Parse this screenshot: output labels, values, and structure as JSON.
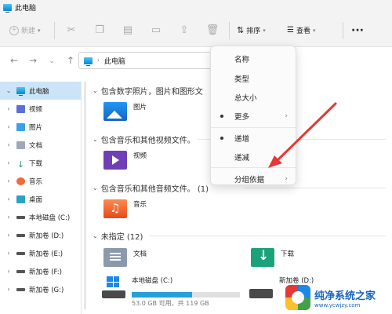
{
  "window": {
    "title": "此电脑"
  },
  "toolbar": {
    "new_label": "新建",
    "sort_label": "排序",
    "view_label": "查看",
    "more_label": "···"
  },
  "address": {
    "path": "此电脑"
  },
  "sidebar": {
    "items": [
      {
        "label": "此电脑",
        "icon": "pc-icon",
        "selected": true,
        "expanded": true
      },
      {
        "label": "视频",
        "icon": "video-folder-icon"
      },
      {
        "label": "图片",
        "icon": "picture-folder-icon"
      },
      {
        "label": "文档",
        "icon": "document-folder-icon"
      },
      {
        "label": "下载",
        "icon": "download-folder-icon"
      },
      {
        "label": "音乐",
        "icon": "music-folder-icon"
      },
      {
        "label": "桌面",
        "icon": "desktop-folder-icon"
      },
      {
        "label": "本地磁盘 (C:)",
        "icon": "drive-icon"
      },
      {
        "label": "新加卷 (D:)",
        "icon": "drive-icon"
      },
      {
        "label": "新加卷 (E:)",
        "icon": "drive-icon"
      },
      {
        "label": "新加卷 (F:)",
        "icon": "drive-icon"
      },
      {
        "label": "新加卷 (G:)",
        "icon": "drive-icon"
      }
    ]
  },
  "groups": [
    {
      "header": "包含数字照片，图片和图形文",
      "items": [
        "图片"
      ]
    },
    {
      "header": "包含音乐和其他视频文件。",
      "items": [
        "视频"
      ]
    },
    {
      "header": "包含音乐和其他音频文件。 (1)",
      "items": [
        "音乐"
      ]
    },
    {
      "header": "未指定 (12)",
      "items": [
        "文档",
        "下载",
        "本地磁盘 (C:)",
        "新加卷 (D:)"
      ]
    }
  ],
  "drive_c": {
    "capacity_text": "53.0 GB 可用，共 119 GB",
    "used_fraction": 0.555
  },
  "sort_menu": {
    "items": [
      {
        "label": "名称",
        "dot": false,
        "submenu": false
      },
      {
        "label": "类型",
        "dot": false,
        "submenu": false
      },
      {
        "label": "总大小",
        "dot": false,
        "submenu": false
      },
      {
        "label": "更多",
        "dot": true,
        "submenu": true
      },
      {
        "label": "递增",
        "dot": true,
        "submenu": false
      },
      {
        "label": "递减",
        "dot": false,
        "submenu": false
      },
      {
        "label": "分组依据",
        "dot": false,
        "submenu": true
      }
    ]
  },
  "colors": {
    "accent": "#0078d4",
    "annotation_arrow": "#e53935",
    "selection": "#cce4f7"
  },
  "watermark": {
    "brand": "纯净系统之家",
    "url": "www.ycwjzy.com"
  }
}
